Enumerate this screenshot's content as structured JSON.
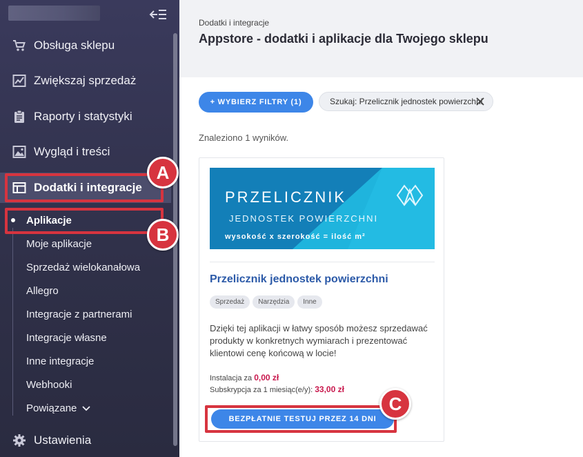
{
  "colors": {
    "accent": "#3d86e8",
    "highlight": "#d7343f",
    "price": "#c8174c",
    "sidebar": "#2f3048"
  },
  "sidebar": {
    "items": [
      {
        "label": "Obsługa sklepu",
        "icon": "cart-icon"
      },
      {
        "label": "Zwiększaj sprzedaż",
        "icon": "chart-icon"
      },
      {
        "label": "Raporty i statystyki",
        "icon": "clipboard-icon"
      },
      {
        "label": "Wygląd i treści",
        "icon": "image-icon"
      },
      {
        "label": "Dodatki i integracje",
        "icon": "window-icon",
        "active": true
      },
      {
        "label": "Ustawienia",
        "icon": "gear-icon"
      }
    ],
    "subitems": [
      {
        "label": "Aplikacje",
        "active": true
      },
      {
        "label": "Moje aplikacje"
      },
      {
        "label": "Sprzedaż wielokanałowa"
      },
      {
        "label": "Allegro"
      },
      {
        "label": "Integracje z partnerami"
      },
      {
        "label": "Integracje własne"
      },
      {
        "label": "Inne integracje"
      },
      {
        "label": "Webhooki"
      },
      {
        "label": "Powiązane"
      }
    ]
  },
  "markers": [
    "A",
    "B",
    "C"
  ],
  "header": {
    "breadcrumb": "Dodatki i integracje",
    "title": "Appstore - dodatki i aplikacje dla Twojego sklepu"
  },
  "filters": {
    "button_label": "+ WYBIERZ FILTRY (1)",
    "search_chip": "Szukaj: Przelicznik jednostek powierzchni"
  },
  "results_text": "Znaleziono 1 wyników.",
  "card": {
    "banner": {
      "line1": "PRZELICZNIK",
      "line2": "JEDNOSTEK POWIERZCHNI",
      "line3": "wysokość x szerokość = ilość m²"
    },
    "title": "Przelicznik jednostek powierzchni",
    "tags": [
      "Sprzedaż",
      "Narzędzia",
      "Inne"
    ],
    "description": "Dzięki tej aplikacji w łatwy sposób możesz sprzedawać produkty w konkretnych wymiarach i prezentować klientowi cenę końcową w locie!",
    "install_label": "Instalacja za",
    "install_price": "0,00 zł",
    "subscription_label": "Subskrypcja za 1 miesiąc(e/y):",
    "subscription_price": "33,00 zł",
    "cta": "BEZPŁATNIE TESTUJ PRZEZ 14 DNI"
  }
}
